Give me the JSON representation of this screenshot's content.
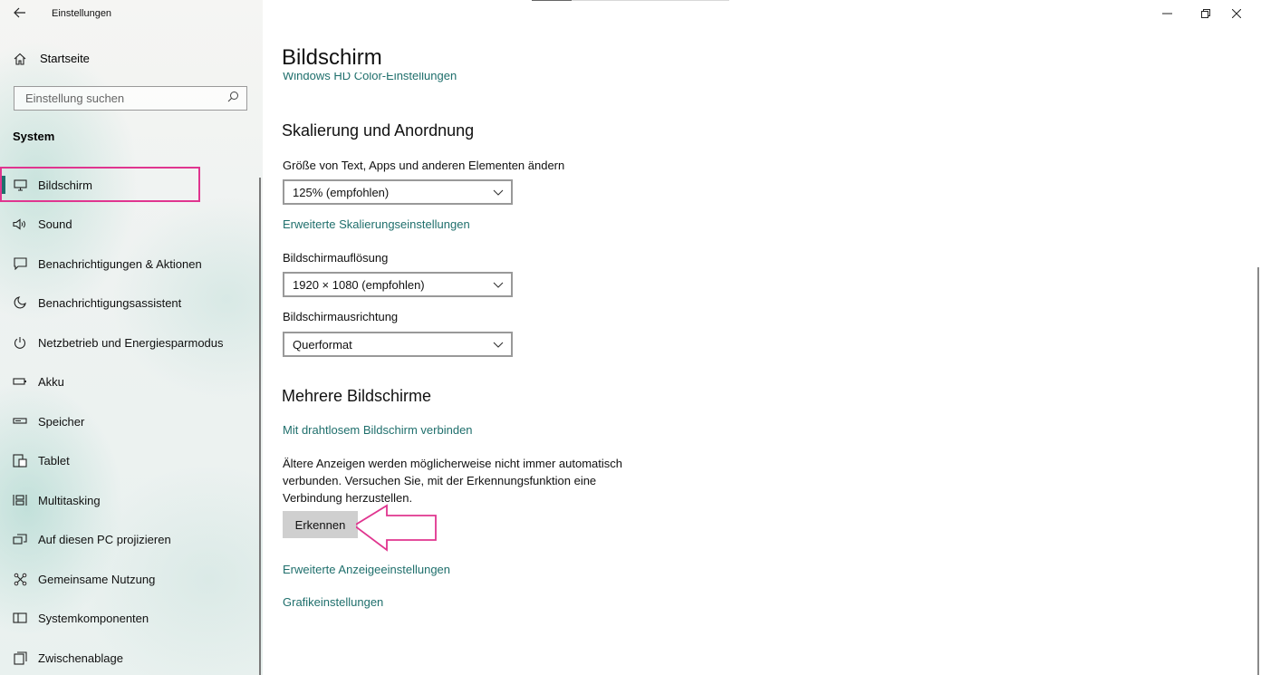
{
  "window": {
    "app_title": "Einstellungen",
    "back_icon": "arrow-left-icon",
    "controls": [
      "minimize-icon",
      "restore-icon",
      "close-icon"
    ]
  },
  "sidebar": {
    "home_label": "Startseite",
    "search_placeholder": "Einstellung suchen",
    "section_title": "System",
    "items": [
      {
        "label": "Bildschirm",
        "icon": "monitor-icon",
        "active": true
      },
      {
        "label": "Sound",
        "icon": "speaker-icon"
      },
      {
        "label": "Benachrichtigungen & Aktionen",
        "icon": "notification-icon"
      },
      {
        "label": "Benachrichtigungsassistent",
        "icon": "moon-icon"
      },
      {
        "label": "Netzbetrieb und Energiesparmodus",
        "icon": "power-icon"
      },
      {
        "label": "Akku",
        "icon": "battery-icon"
      },
      {
        "label": "Speicher",
        "icon": "storage-icon"
      },
      {
        "label": "Tablet",
        "icon": "tablet-icon"
      },
      {
        "label": "Multitasking",
        "icon": "multitasking-icon"
      },
      {
        "label": "Auf diesen PC projizieren",
        "icon": "project-icon"
      },
      {
        "label": "Gemeinsame Nutzung",
        "icon": "share-icon"
      },
      {
        "label": "Systemkomponenten",
        "icon": "components-icon"
      },
      {
        "label": "Zwischenablage",
        "icon": "clipboard-icon"
      }
    ]
  },
  "main": {
    "page_title": "Bildschirm",
    "clipped_link": "Windows HD Color-Einstellungen",
    "scaling": {
      "heading": "Skalierung und Anordnung",
      "size_label": "Größe von Text, Apps und anderen Elementen ändern",
      "size_value": "125% (empfohlen)",
      "advanced_link": "Erweiterte Skalierungseinstellungen",
      "resolution_label": "Bildschirmauflösung",
      "resolution_value": "1920 × 1080 (empfohlen)",
      "orientation_label": "Bildschirmausrichtung",
      "orientation_value": "Querformat"
    },
    "multi": {
      "heading": "Mehrere Bildschirme",
      "wireless_link": "Mit drahtlosem Bildschirm verbinden",
      "description": "Ältere Anzeigen werden möglicherweise nicht immer automatisch verbunden. Versuchen Sie, mit der Erkennungsfunktion eine Verbindung herzustellen.",
      "detect_button": "Erkennen",
      "advanced_display_link": "Erweiterte Anzeigeeinstellungen",
      "graphics_link": "Grafikeinstellungen"
    }
  },
  "colors": {
    "accent": "#1f6f6c",
    "highlight": "#e0358f"
  }
}
